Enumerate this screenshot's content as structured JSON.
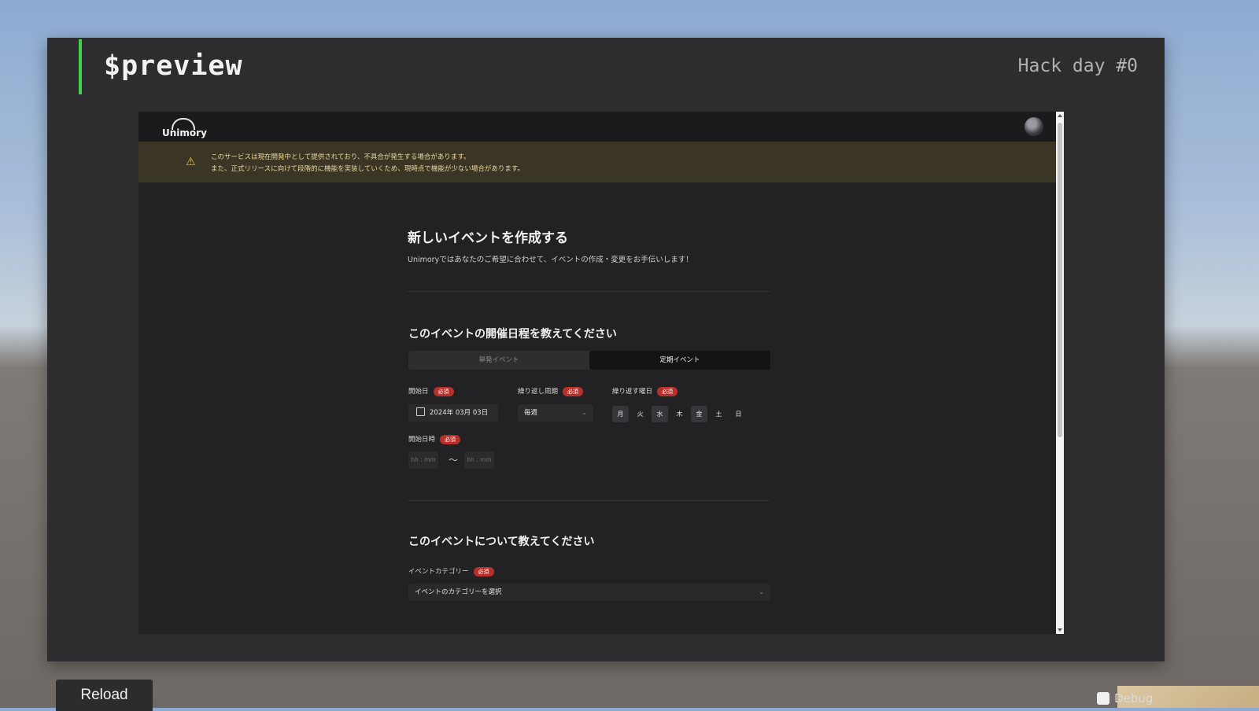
{
  "panel": {
    "title": "$preview",
    "tag": "Hack day #0"
  },
  "site": {
    "logo_text": "Unimory",
    "notice_icon": "warning-triangle-icon",
    "notice_lines": [
      "このサービスは現在開発中として提供されており、不具合が発生する場合があります。",
      "また、正式リリースに向けて段階的に機能を実装していくため、現時点で機能が少ない場合があります。"
    ],
    "page_title": "新しいイベントを作成する",
    "page_subtitle": "Unimoryではあなたのご希望に合わせて、イベントの作成・変更をお手伝いします！",
    "schedule_heading": "このイベントの開催日程を教えてください",
    "event_type_options": [
      "単発イベント",
      "定期イベント"
    ],
    "selected_event_type": "定期イベント",
    "required_badge": "必須",
    "start_date_label": "開始日",
    "start_date_value": "2024年 03月 03日",
    "repeat_cycle_label": "繰り返し周期",
    "repeat_cycle_value": "毎週",
    "repeat_days_label": "繰り返す曜日",
    "weekdays": [
      "月",
      "火",
      "水",
      "木",
      "金",
      "土",
      "日"
    ],
    "selected_weekdays": [
      "月",
      "水",
      "金"
    ],
    "start_time_label": "開始日時",
    "time_placeholder_start": "hh : mm",
    "time_separator": "〜",
    "time_placeholder_end": "hh : mm",
    "about_heading": "このイベントについて教えてください",
    "category_label": "イベントカテゴリー",
    "category_placeholder": "イベントのカテゴリーを選択"
  },
  "controls": {
    "reload_label": "Reload",
    "debug_label": "Debug"
  },
  "colors": {
    "accent_green": "#43d14a",
    "required_red": "#b8302b",
    "notice_bg": "#3b3525"
  }
}
